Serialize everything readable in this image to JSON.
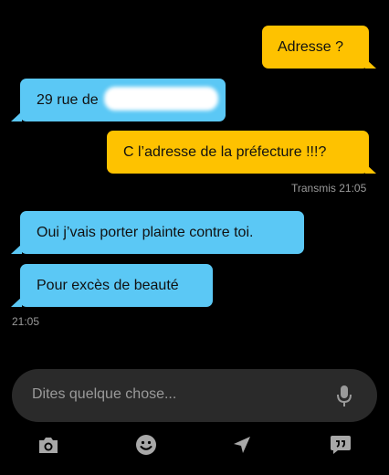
{
  "messages": [
    {
      "text": "Adresse ?",
      "sender": "me"
    },
    {
      "text": "29 rue de",
      "sender": "them"
    },
    {
      "text": "C l’adresse de la préfecture !!!?",
      "sender": "me",
      "status": "Transmis 21:05"
    },
    {
      "text": "Oui j’vais porter plainte contre toi.",
      "sender": "them"
    },
    {
      "text": "Pour excès de beauté",
      "sender": "them",
      "time": "21:05"
    }
  ],
  "composer": {
    "placeholder": "Dites quelque chose..."
  },
  "icons": {
    "mic": "microphone-icon",
    "camera": "camera-icon",
    "emoji": "emoji-icon",
    "location": "location-arrow-icon",
    "quick_reply": "quick-reply-icon"
  },
  "colors": {
    "background": "#000000",
    "my_bubble": "#fec200",
    "their_bubble": "#5bc8f5",
    "composer": "#2a2a2a",
    "meta_text": "#9a9a9a"
  }
}
